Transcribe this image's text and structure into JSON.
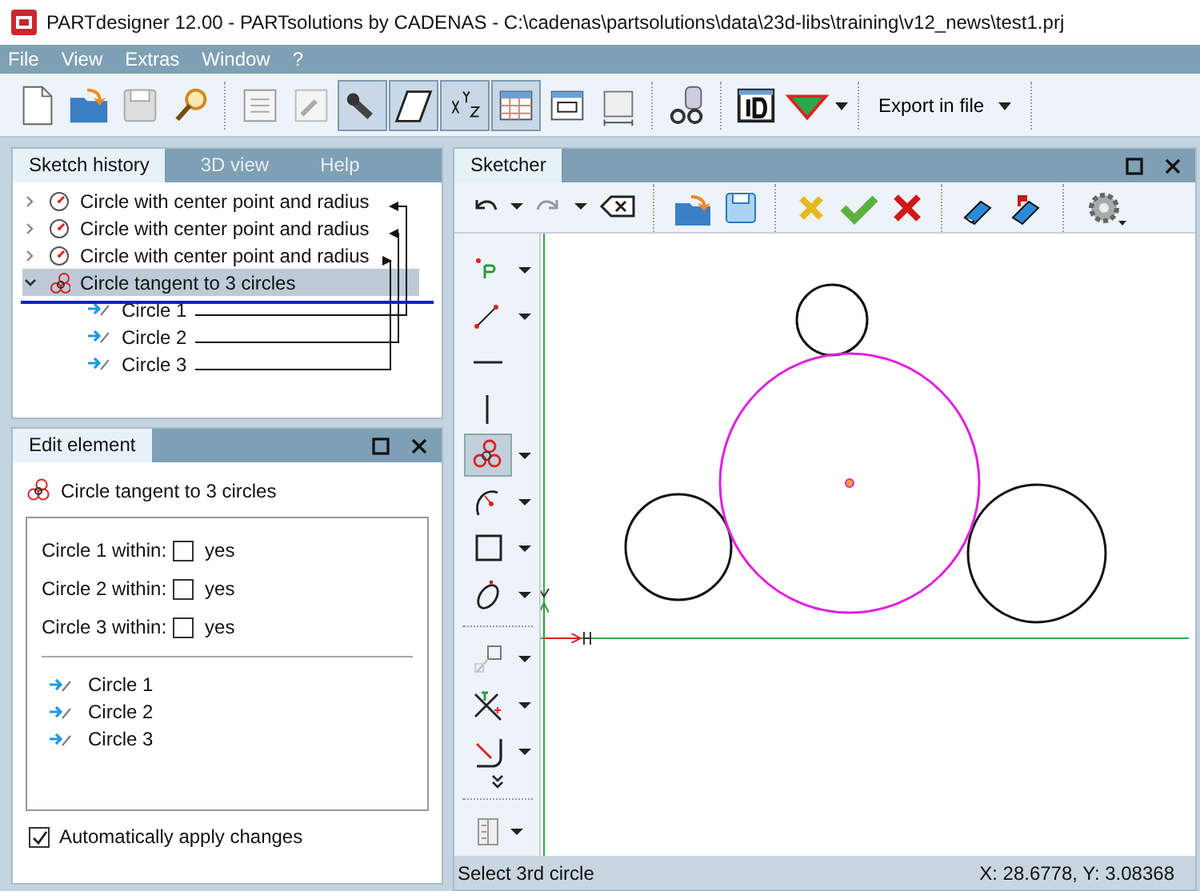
{
  "window": {
    "title": "PARTdesigner 12.00 - PARTsolutions by CADENAS - C:\\cadenas\\partsolutions\\data\\23d-libs\\training\\v12_news\\test1.prj"
  },
  "menu": [
    "File",
    "View",
    "Extras",
    "Window",
    "?"
  ],
  "toolbar": {
    "buttons": [
      {
        "pressed": false
      },
      {
        "pressed": false
      },
      {
        "pressed": false
      },
      {
        "pressed": false
      },
      {
        "pressed": false
      },
      {
        "pressed": false
      },
      {
        "pressed": true
      },
      {
        "pressed": true
      },
      {
        "pressed": true
      },
      {
        "pressed": true
      },
      {
        "pressed": false
      },
      {
        "pressed": false
      },
      {
        "pressed": false
      },
      {
        "pressed": false
      },
      {
        "pressed": false
      }
    ],
    "export_label": "Export in file"
  },
  "sketch_history": {
    "tabs": [
      {
        "label": "Sketch history",
        "selected": true
      },
      {
        "label": "3D view",
        "selected": false
      },
      {
        "label": "Help",
        "selected": false
      }
    ],
    "tree": [
      {
        "label": "Circle with center point and radius",
        "kind": "circle",
        "expanded": false,
        "selected": false
      },
      {
        "label": "Circle with center point and radius",
        "kind": "circle",
        "expanded": false,
        "selected": false
      },
      {
        "label": "Circle with center point and radius",
        "kind": "circle",
        "expanded": false,
        "selected": false
      },
      {
        "label": "Circle tangent to 3 circles",
        "kind": "tangent",
        "expanded": true,
        "selected": true,
        "children": [
          {
            "label": "Circle 1",
            "kind": "reference"
          },
          {
            "label": "Circle 2",
            "kind": "reference"
          },
          {
            "label": "Circle 3",
            "kind": "reference"
          }
        ]
      }
    ]
  },
  "edit_element": {
    "tab": "Edit element",
    "heading": "Circle tangent to 3 circles",
    "options": [
      {
        "label": "Circle 1 within:",
        "option": "yes",
        "checked": false
      },
      {
        "label": "Circle 2 within:",
        "option": "yes",
        "checked": false
      },
      {
        "label": "Circle 3 within:",
        "option": "yes",
        "checked": false
      }
    ],
    "references": [
      "Circle 1",
      "Circle 2",
      "Circle 3"
    ],
    "auto_apply": {
      "label": "Automatically apply changes",
      "checked": true
    }
  },
  "sketcher": {
    "tab": "Sketcher",
    "tools": [
      {
        "pressed": false
      },
      {
        "pressed": false
      },
      {
        "pressed": false
      },
      {
        "pressed": false
      },
      {
        "pressed": true
      },
      {
        "pressed": false
      },
      {
        "pressed": false
      },
      {
        "pressed": false
      },
      {
        "pressed": false
      },
      {
        "pressed": false
      },
      {
        "pressed": false
      }
    ],
    "status": "Select 3rd circle",
    "coordinates": "X: 28.6778, Y: 3.08368"
  }
}
